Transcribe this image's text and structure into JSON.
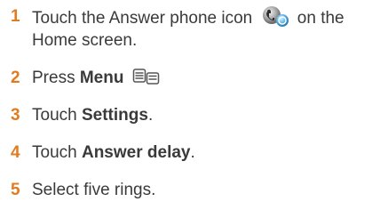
{
  "steps": [
    {
      "num": "1",
      "text_before": "Touch the Answer phone icon",
      "icon": "answer-phone-icon",
      "text_after": "on the Home screen."
    },
    {
      "num": "2",
      "text_before": "Press ",
      "bold": "Menu",
      "icon": "menu-icon"
    },
    {
      "num": "3",
      "text_before": "Touch ",
      "bold": "Settings",
      "text_after": "."
    },
    {
      "num": "4",
      "text_before": "Touch ",
      "bold": "Answer delay",
      "text_after": "."
    },
    {
      "num": "5",
      "text_before": "Select five rings."
    }
  ],
  "colors": {
    "step_number": "#e27b1e",
    "text": "#3a3a3a"
  }
}
